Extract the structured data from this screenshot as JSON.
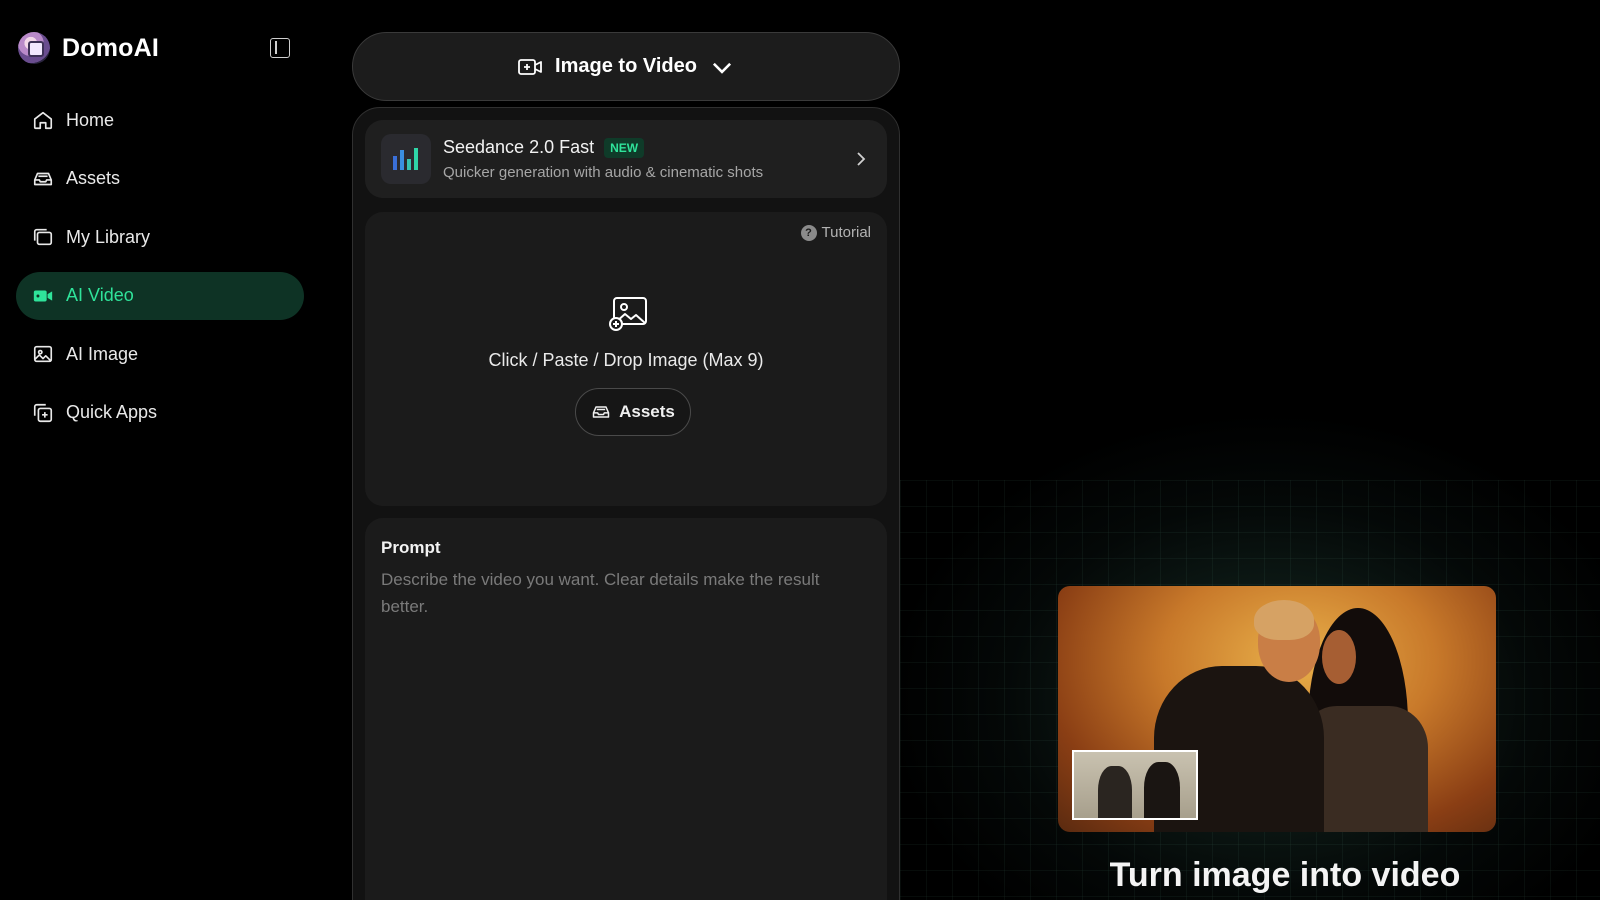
{
  "brand": {
    "name": "DomoAI"
  },
  "sidebar": {
    "items": [
      {
        "label": "Home",
        "icon": "home-icon"
      },
      {
        "label": "Assets",
        "icon": "assets-icon"
      },
      {
        "label": "My Library",
        "icon": "library-icon"
      },
      {
        "label": "AI Video",
        "icon": "video-icon",
        "active": true
      },
      {
        "label": "AI Image",
        "icon": "image-icon"
      },
      {
        "label": "Quick Apps",
        "icon": "quick-apps-icon"
      }
    ]
  },
  "mode": {
    "label": "Image to Video"
  },
  "model": {
    "title": "Seedance 2.0 Fast",
    "badge": "NEW",
    "subtitle": "Quicker generation with audio & cinematic shots"
  },
  "upload": {
    "tutorial_label": "Tutorial",
    "instruction": "Click / Paste / Drop Image (Max 9)",
    "assets_label": "Assets"
  },
  "prompt": {
    "label": "Prompt",
    "placeholder": "Describe the video you want. Clear details make the result better.",
    "value": ""
  },
  "preview": {
    "title": "Turn image into video"
  },
  "colors": {
    "accent": "#2fe39a",
    "active_bg": "#0e3325",
    "panel_bg": "#121212",
    "card_bg": "#1f1f1f"
  }
}
